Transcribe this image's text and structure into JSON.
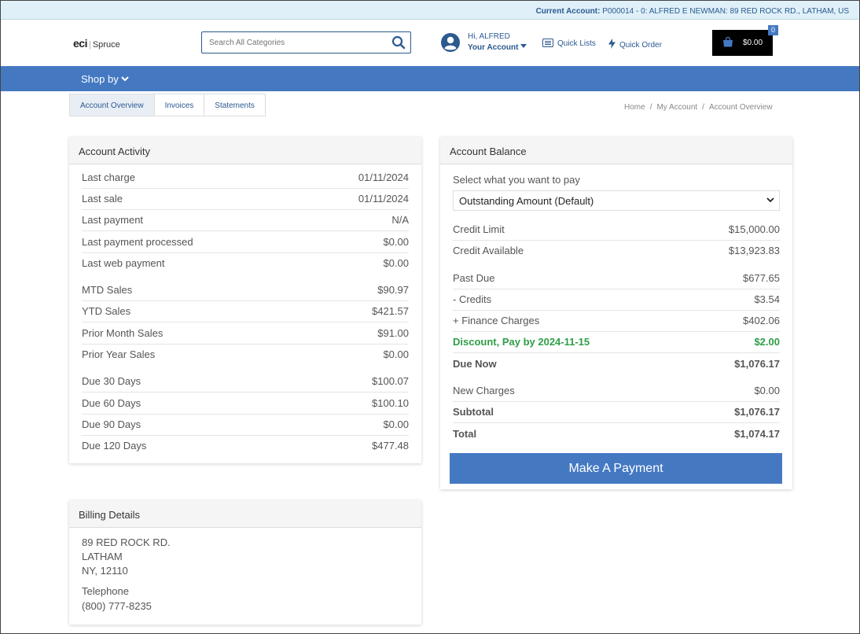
{
  "topbar": {
    "label": "Current Account:",
    "value": "P000014 - 0: ALFRED E NEWMAN: 89 RED ROCK RD., LATHAM, US"
  },
  "logo": {
    "brand": "eci",
    "product": "Spruce"
  },
  "search": {
    "placeholder": "Search All Categories"
  },
  "user": {
    "greeting": "Hi, ALFRED",
    "account_label": "Your Account"
  },
  "links": {
    "quick_lists": "Quick Lists",
    "quick_order": "Quick Order"
  },
  "cart": {
    "amount": "$0.00",
    "count": "0"
  },
  "nav": {
    "shop_by": "Shop by"
  },
  "tabs": [
    "Account Overview",
    "Invoices",
    "Statements"
  ],
  "breadcrumb": [
    "Home",
    "My Account",
    "Account Overview"
  ],
  "activity": {
    "title": "Account Activity",
    "rows": [
      {
        "label": "Last charge",
        "value": "01/11/2024"
      },
      {
        "label": "Last sale",
        "value": "01/11/2024"
      },
      {
        "label": "Last payment",
        "value": "N/A"
      },
      {
        "label": "Last payment processed",
        "value": "$0.00"
      },
      {
        "label": "Last web payment",
        "value": "$0.00"
      },
      {
        "label": "MTD Sales",
        "value": "$90.97"
      },
      {
        "label": "YTD Sales",
        "value": "$421.57"
      },
      {
        "label": "Prior Month Sales",
        "value": "$91.00"
      },
      {
        "label": "Prior Year Sales",
        "value": "$0.00"
      },
      {
        "label": "Due 30 Days",
        "value": "$100.07"
      },
      {
        "label": "Due 60 Days",
        "value": "$100.10"
      },
      {
        "label": "Due 90 Days",
        "value": "$0.00"
      },
      {
        "label": "Due 120 Days",
        "value": "$477.48"
      }
    ]
  },
  "balance": {
    "title": "Account Balance",
    "select_label": "Select what you want to pay",
    "select_value": "Outstanding Amount (Default)",
    "rows": [
      {
        "label": "Credit Limit",
        "value": "$15,000.00"
      },
      {
        "label": "Credit Available",
        "value": "$13,923.83"
      },
      {
        "label": "Past Due",
        "value": "$677.65"
      },
      {
        "label": "- Credits",
        "value": "$3.54"
      },
      {
        "label": "+ Finance Charges",
        "value": "$402.06"
      },
      {
        "label": "Discount, Pay by 2024-11-15",
        "value": "$2.00"
      },
      {
        "label": "Due Now",
        "value": "$1,076.17"
      },
      {
        "label": "New Charges",
        "value": "$0.00"
      },
      {
        "label": "Subtotal",
        "value": "$1,076.17"
      },
      {
        "label": "Total",
        "value": "$1,074.17"
      }
    ],
    "pay_button": "Make A Payment"
  },
  "billing": {
    "title": "Billing Details",
    "address1": "89 RED ROCK RD.",
    "address2": "LATHAM",
    "address3": "NY, 12110",
    "phone_label": "Telephone",
    "phone": "(800) 777-8235"
  },
  "colors": {
    "primary": "#4479c2",
    "link": "#2b5a91",
    "discount": "#2e9e47",
    "topbar_bg": "#dff0f8"
  }
}
